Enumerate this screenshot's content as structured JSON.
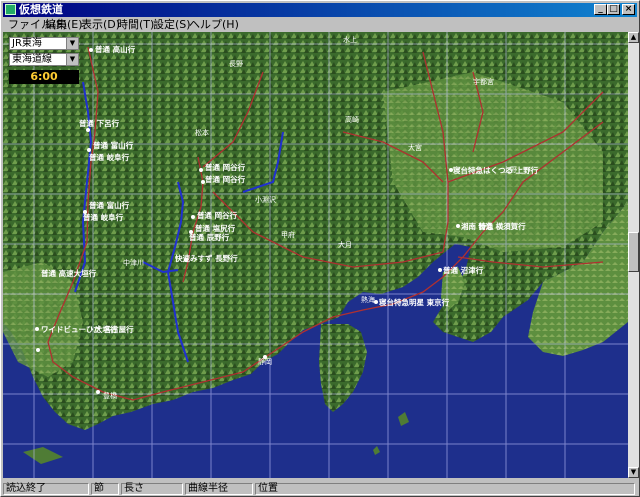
{
  "window": {
    "title": "仮想鉄道"
  },
  "title_buttons": {
    "minimize": "_",
    "maximize": "□",
    "close": "×"
  },
  "menu": [
    "ファイル(F)",
    "編集(E)",
    "表示(D)",
    "時間(T)",
    "設定(S)",
    "ヘルプ(H)"
  ],
  "controls": {
    "line_select": "JR東海",
    "route_select": "東海道線",
    "clock": "6:00"
  },
  "map": {
    "labels": [
      {
        "text": "普通 高山行",
        "kind": "train"
      },
      {
        "text": "普通 下呂行",
        "kind": "train"
      },
      {
        "text": "普通 富山行",
        "kind": "train"
      },
      {
        "text": "普通 岐阜行",
        "kind": "train"
      },
      {
        "text": "普通 富山行",
        "kind": "train"
      },
      {
        "text": "普通 岐阜行",
        "kind": "train"
      },
      {
        "text": "普通 岡谷行",
        "kind": "train"
      },
      {
        "text": "普通 岡谷行",
        "kind": "train"
      },
      {
        "text": "普通 岡谷行",
        "kind": "train"
      },
      {
        "text": "普通 塩尻行",
        "kind": "train"
      },
      {
        "text": "普通 辰野行",
        "kind": "train"
      },
      {
        "text": "快速みすず 長野行",
        "kind": "train"
      },
      {
        "text": "普通 高速大垣行",
        "kind": "train"
      },
      {
        "text": "ワイドビューひだ 名古屋行",
        "kind": "train"
      },
      {
        "text": "大垣行",
        "kind": "train"
      },
      {
        "text": "寝台特急はくつる 上野行",
        "kind": "train"
      },
      {
        "text": "湘南 特急",
        "kind": "train"
      },
      {
        "text": "普通 横須賀行",
        "kind": "train"
      },
      {
        "text": "寝台特急明星 東京行",
        "kind": "train"
      },
      {
        "text": "普通 沼津行",
        "kind": "train"
      },
      {
        "text": "長野",
        "kind": "city"
      },
      {
        "text": "松本",
        "kind": "city"
      },
      {
        "text": "甲府",
        "kind": "city"
      },
      {
        "text": "静岡",
        "kind": "city"
      },
      {
        "text": "豊橋",
        "kind": "city"
      },
      {
        "text": "高崎",
        "kind": "city"
      },
      {
        "text": "大宮",
        "kind": "city"
      },
      {
        "text": "上野",
        "kind": "city"
      },
      {
        "text": "大月",
        "kind": "city"
      },
      {
        "text": "熱海",
        "kind": "city"
      },
      {
        "text": "小淵沢",
        "kind": "city"
      },
      {
        "text": "中津川",
        "kind": "city"
      },
      {
        "text": "宇都宮",
        "kind": "city"
      },
      {
        "text": "水上",
        "kind": "city"
      }
    ]
  },
  "statusbar": [
    "読込終了",
    "節",
    "長さ",
    "曲線半径",
    "位置"
  ],
  "colors": {
    "titlebar_start": "#000080",
    "titlebar_end": "#1084d0",
    "sea": "#1e2f8c",
    "mountain": "#3d6b2e",
    "route_line": "#b03030",
    "river": "#2030d0",
    "label": "#ffffff",
    "clock": "#ffcc33"
  }
}
